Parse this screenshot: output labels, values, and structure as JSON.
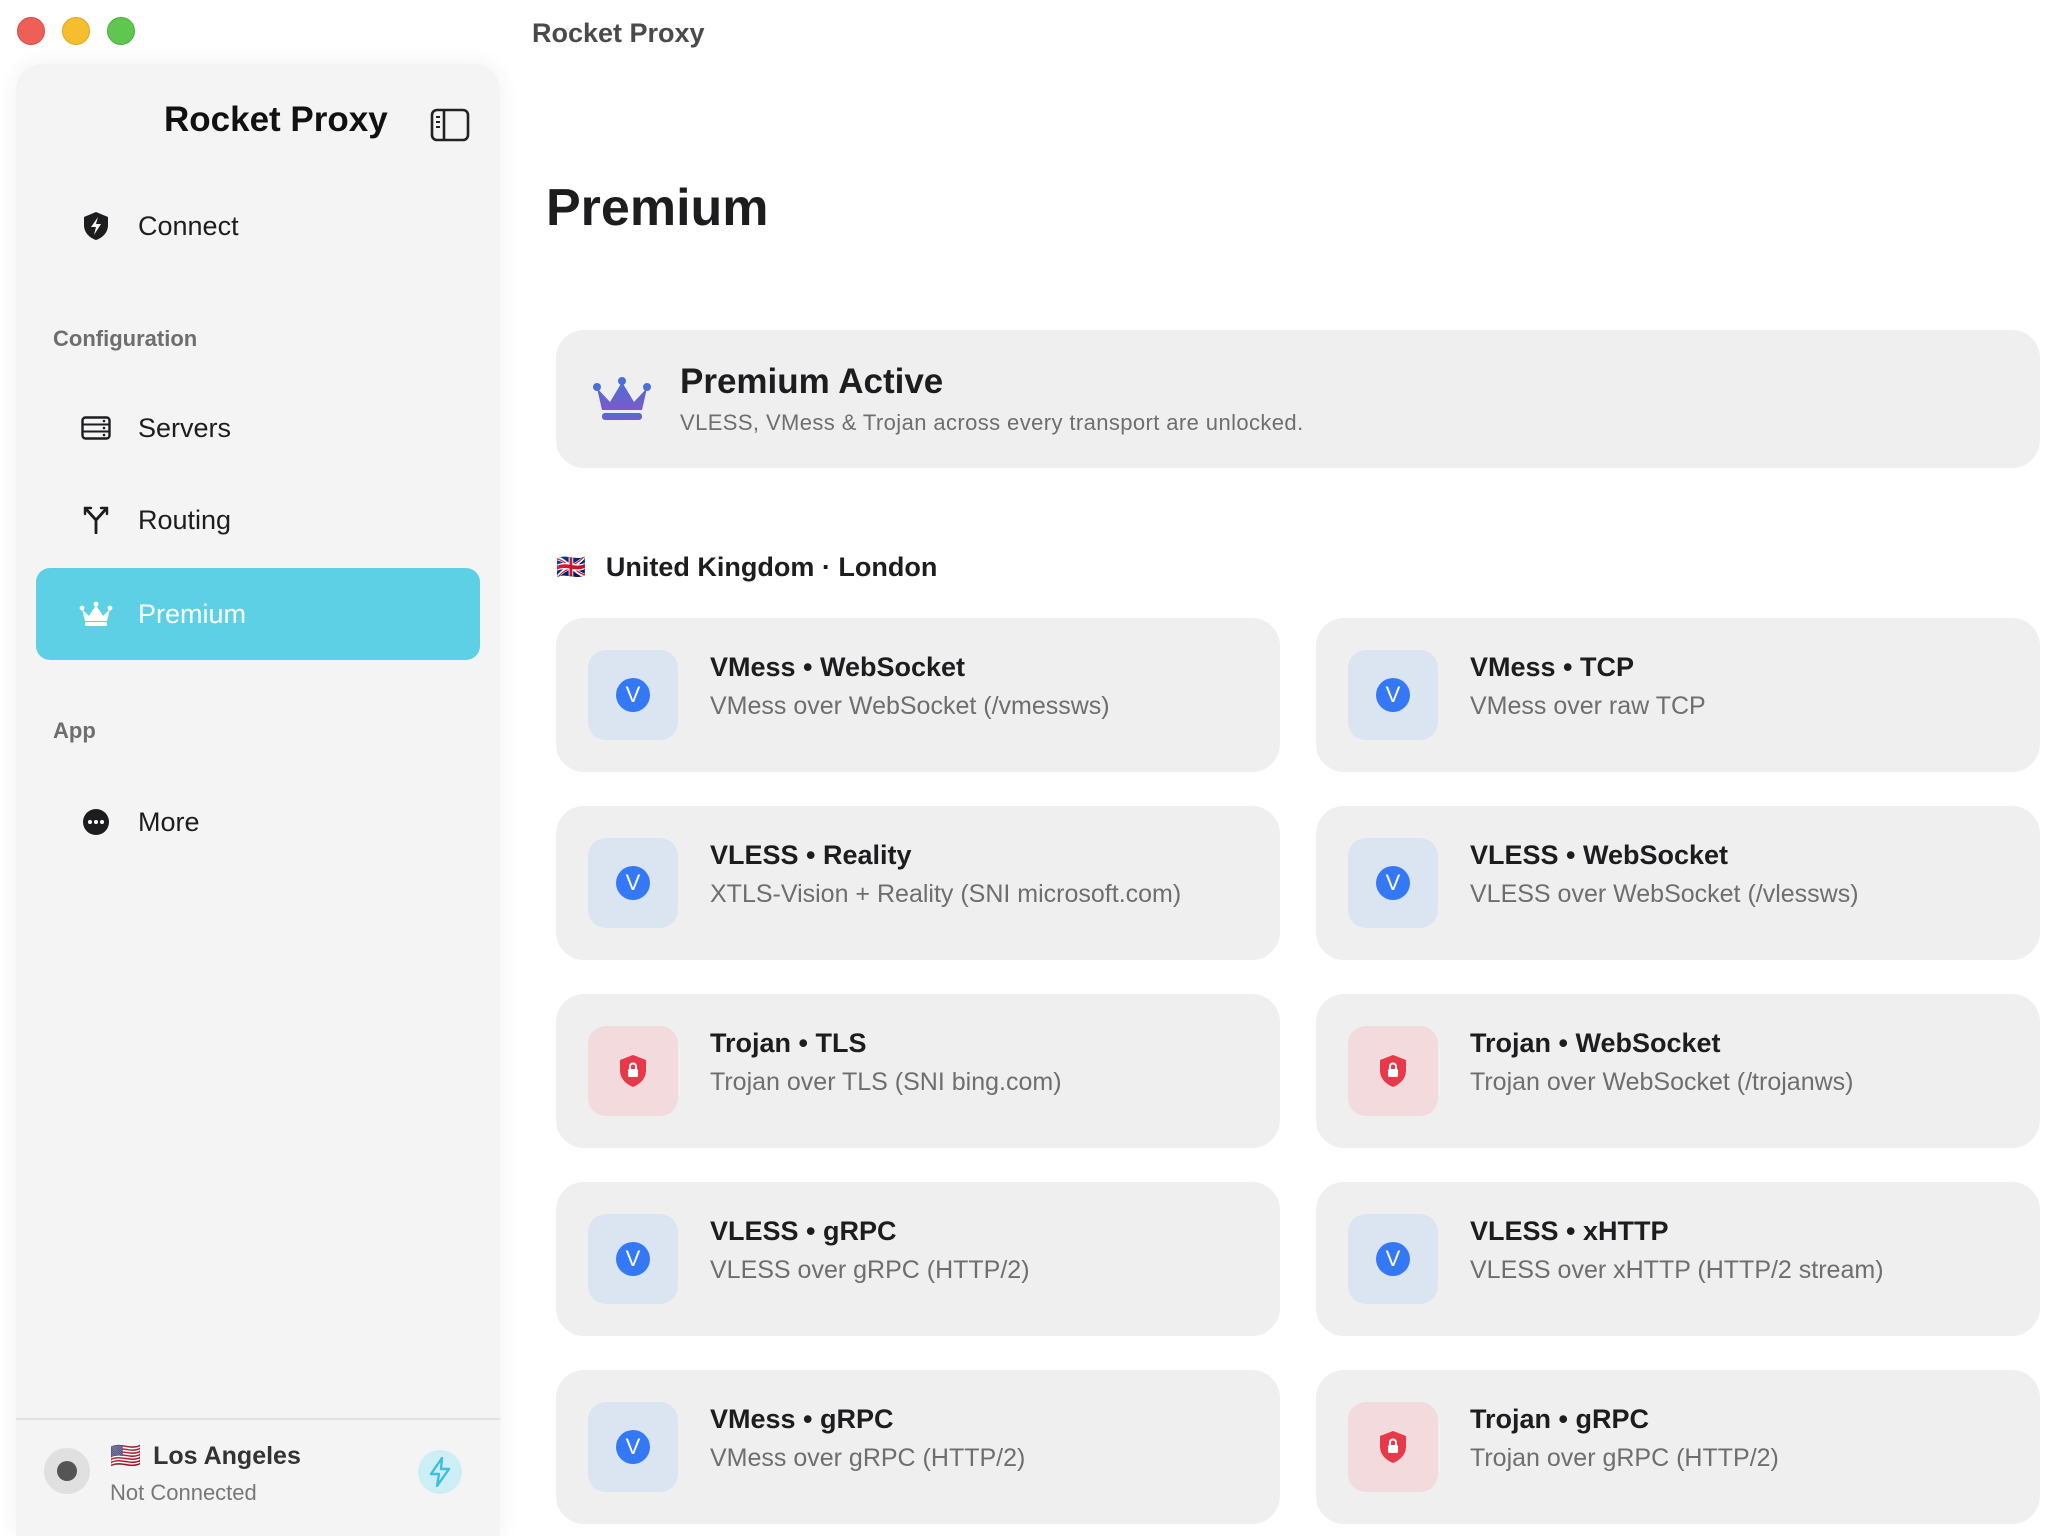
{
  "window": {
    "title": "Rocket Proxy"
  },
  "sidebar": {
    "title": "Rocket Proxy",
    "connect_label": "Connect",
    "sections": {
      "configuration": "Configuration",
      "app": "App"
    },
    "items": [
      {
        "label": "Servers",
        "icon": "server-rack-icon"
      },
      {
        "label": "Routing",
        "icon": "routing-fork-icon"
      },
      {
        "label": "Premium",
        "icon": "crown-icon",
        "active": true
      },
      {
        "label": "More",
        "icon": "ellipsis-circle-icon"
      }
    ],
    "footer": {
      "location": "Los Angeles",
      "status": "Not Connected",
      "flag": "🇺🇸"
    }
  },
  "main": {
    "title": "Premium",
    "banner": {
      "title": "Premium Active",
      "subtitle": "VLESS, VMess & Trojan across every transport are unlocked."
    },
    "region": {
      "flag": "🇬🇧",
      "label": "United Kingdom · London"
    },
    "servers": [
      {
        "title": "VMess • WebSocket",
        "subtitle": "VMess over WebSocket (/vmessws)",
        "kind": "vmess"
      },
      {
        "title": "VMess • TCP",
        "subtitle": "VMess over raw TCP",
        "kind": "vmess"
      },
      {
        "title": "VLESS • Reality",
        "subtitle": "XTLS-Vision + Reality (SNI microsoft.com)",
        "kind": "vmess"
      },
      {
        "title": "VLESS • WebSocket",
        "subtitle": "VLESS over WebSocket (/vlessws)",
        "kind": "vmess"
      },
      {
        "title": "Trojan • TLS",
        "subtitle": "Trojan over TLS (SNI bing.com)",
        "kind": "trojan"
      },
      {
        "title": "Trojan • WebSocket",
        "subtitle": "Trojan over WebSocket (/trojanws)",
        "kind": "trojan"
      },
      {
        "title": "VLESS • gRPC",
        "subtitle": "VLESS over gRPC (HTTP/2)",
        "kind": "vmess"
      },
      {
        "title": "VLESS • xHTTP",
        "subtitle": "VLESS over xHTTP (HTTP/2 stream)",
        "kind": "vmess"
      },
      {
        "title": "VMess • gRPC",
        "subtitle": "VMess over gRPC (HTTP/2)",
        "kind": "vmess"
      },
      {
        "title": "Trojan • gRPC",
        "subtitle": "Trojan over gRPC (HTTP/2)",
        "kind": "trojan"
      }
    ],
    "protocol_badge": "V"
  },
  "colors": {
    "accent": "#5ed0e6",
    "vmess_blue": "#3478f6",
    "trojan_red": "#e8394a",
    "card_bg": "#efefef"
  }
}
